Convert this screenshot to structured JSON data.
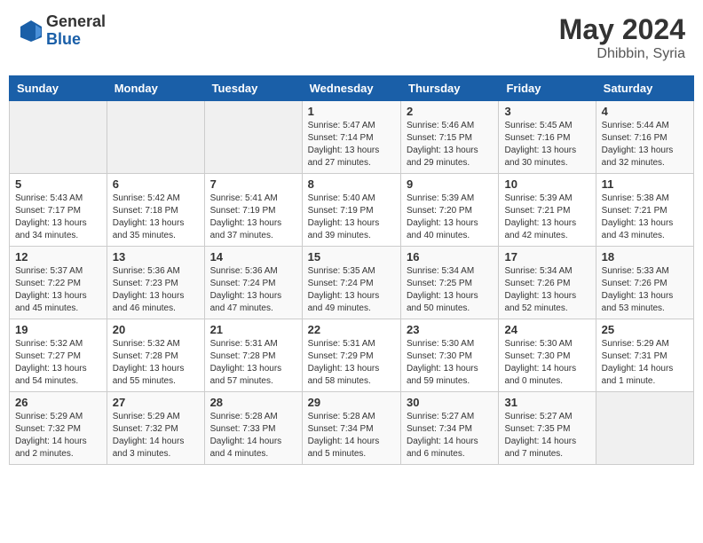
{
  "header": {
    "logo_general": "General",
    "logo_blue": "Blue",
    "month_year": "May 2024",
    "location": "Dhibbin, Syria"
  },
  "weekdays": [
    "Sunday",
    "Monday",
    "Tuesday",
    "Wednesday",
    "Thursday",
    "Friday",
    "Saturday"
  ],
  "weeks": [
    [
      {
        "day": "",
        "info": ""
      },
      {
        "day": "",
        "info": ""
      },
      {
        "day": "",
        "info": ""
      },
      {
        "day": "1",
        "info": "Sunrise: 5:47 AM\nSunset: 7:14 PM\nDaylight: 13 hours\nand 27 minutes."
      },
      {
        "day": "2",
        "info": "Sunrise: 5:46 AM\nSunset: 7:15 PM\nDaylight: 13 hours\nand 29 minutes."
      },
      {
        "day": "3",
        "info": "Sunrise: 5:45 AM\nSunset: 7:16 PM\nDaylight: 13 hours\nand 30 minutes."
      },
      {
        "day": "4",
        "info": "Sunrise: 5:44 AM\nSunset: 7:16 PM\nDaylight: 13 hours\nand 32 minutes."
      }
    ],
    [
      {
        "day": "5",
        "info": "Sunrise: 5:43 AM\nSunset: 7:17 PM\nDaylight: 13 hours\nand 34 minutes."
      },
      {
        "day": "6",
        "info": "Sunrise: 5:42 AM\nSunset: 7:18 PM\nDaylight: 13 hours\nand 35 minutes."
      },
      {
        "day": "7",
        "info": "Sunrise: 5:41 AM\nSunset: 7:19 PM\nDaylight: 13 hours\nand 37 minutes."
      },
      {
        "day": "8",
        "info": "Sunrise: 5:40 AM\nSunset: 7:19 PM\nDaylight: 13 hours\nand 39 minutes."
      },
      {
        "day": "9",
        "info": "Sunrise: 5:39 AM\nSunset: 7:20 PM\nDaylight: 13 hours\nand 40 minutes."
      },
      {
        "day": "10",
        "info": "Sunrise: 5:39 AM\nSunset: 7:21 PM\nDaylight: 13 hours\nand 42 minutes."
      },
      {
        "day": "11",
        "info": "Sunrise: 5:38 AM\nSunset: 7:21 PM\nDaylight: 13 hours\nand 43 minutes."
      }
    ],
    [
      {
        "day": "12",
        "info": "Sunrise: 5:37 AM\nSunset: 7:22 PM\nDaylight: 13 hours\nand 45 minutes."
      },
      {
        "day": "13",
        "info": "Sunrise: 5:36 AM\nSunset: 7:23 PM\nDaylight: 13 hours\nand 46 minutes."
      },
      {
        "day": "14",
        "info": "Sunrise: 5:36 AM\nSunset: 7:24 PM\nDaylight: 13 hours\nand 47 minutes."
      },
      {
        "day": "15",
        "info": "Sunrise: 5:35 AM\nSunset: 7:24 PM\nDaylight: 13 hours\nand 49 minutes."
      },
      {
        "day": "16",
        "info": "Sunrise: 5:34 AM\nSunset: 7:25 PM\nDaylight: 13 hours\nand 50 minutes."
      },
      {
        "day": "17",
        "info": "Sunrise: 5:34 AM\nSunset: 7:26 PM\nDaylight: 13 hours\nand 52 minutes."
      },
      {
        "day": "18",
        "info": "Sunrise: 5:33 AM\nSunset: 7:26 PM\nDaylight: 13 hours\nand 53 minutes."
      }
    ],
    [
      {
        "day": "19",
        "info": "Sunrise: 5:32 AM\nSunset: 7:27 PM\nDaylight: 13 hours\nand 54 minutes."
      },
      {
        "day": "20",
        "info": "Sunrise: 5:32 AM\nSunset: 7:28 PM\nDaylight: 13 hours\nand 55 minutes."
      },
      {
        "day": "21",
        "info": "Sunrise: 5:31 AM\nSunset: 7:28 PM\nDaylight: 13 hours\nand 57 minutes."
      },
      {
        "day": "22",
        "info": "Sunrise: 5:31 AM\nSunset: 7:29 PM\nDaylight: 13 hours\nand 58 minutes."
      },
      {
        "day": "23",
        "info": "Sunrise: 5:30 AM\nSunset: 7:30 PM\nDaylight: 13 hours\nand 59 minutes."
      },
      {
        "day": "24",
        "info": "Sunrise: 5:30 AM\nSunset: 7:30 PM\nDaylight: 14 hours\nand 0 minutes."
      },
      {
        "day": "25",
        "info": "Sunrise: 5:29 AM\nSunset: 7:31 PM\nDaylight: 14 hours\nand 1 minute."
      }
    ],
    [
      {
        "day": "26",
        "info": "Sunrise: 5:29 AM\nSunset: 7:32 PM\nDaylight: 14 hours\nand 2 minutes."
      },
      {
        "day": "27",
        "info": "Sunrise: 5:29 AM\nSunset: 7:32 PM\nDaylight: 14 hours\nand 3 minutes."
      },
      {
        "day": "28",
        "info": "Sunrise: 5:28 AM\nSunset: 7:33 PM\nDaylight: 14 hours\nand 4 minutes."
      },
      {
        "day": "29",
        "info": "Sunrise: 5:28 AM\nSunset: 7:34 PM\nDaylight: 14 hours\nand 5 minutes."
      },
      {
        "day": "30",
        "info": "Sunrise: 5:27 AM\nSunset: 7:34 PM\nDaylight: 14 hours\nand 6 minutes."
      },
      {
        "day": "31",
        "info": "Sunrise: 5:27 AM\nSunset: 7:35 PM\nDaylight: 14 hours\nand 7 minutes."
      },
      {
        "day": "",
        "info": ""
      }
    ]
  ]
}
